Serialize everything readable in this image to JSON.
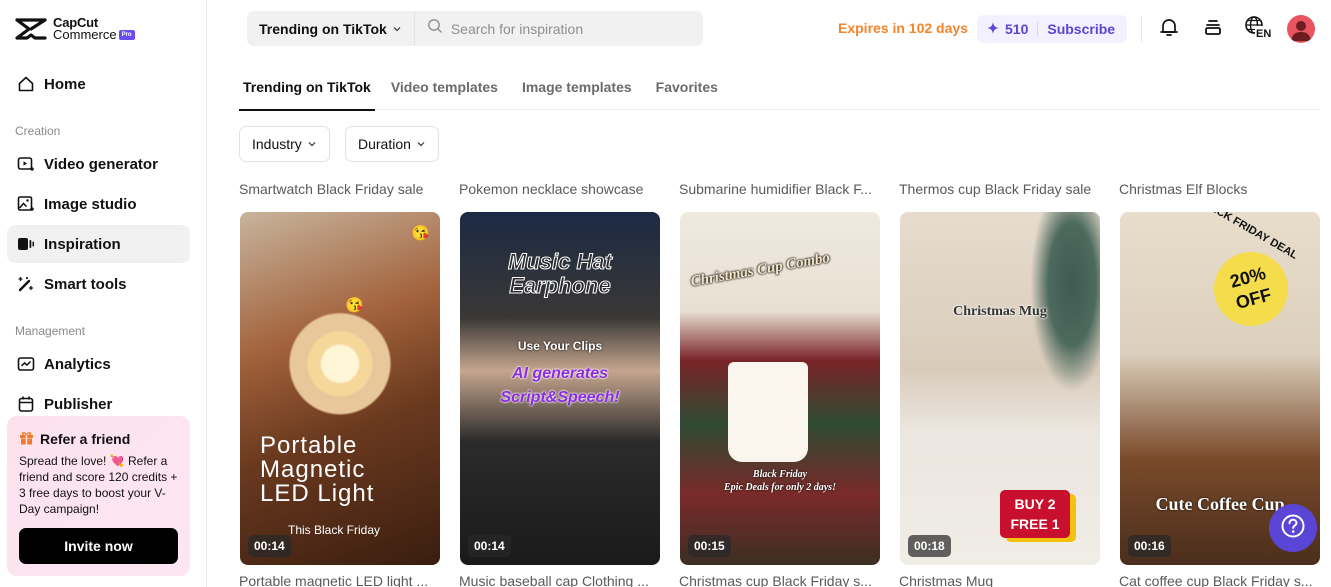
{
  "brand": {
    "line1": "CapCut",
    "line2": "Commerce",
    "badge": "Pro"
  },
  "sidebar": {
    "home": "Home",
    "creation_label": "Creation",
    "creation_items": [
      {
        "label": "Video generator",
        "icon": "video-sparkle-icon"
      },
      {
        "label": "Image studio",
        "icon": "image-sparkle-icon"
      },
      {
        "label": "Inspiration",
        "icon": "inspiration-icon",
        "active": true
      },
      {
        "label": "Smart tools",
        "icon": "magic-wand-icon"
      }
    ],
    "management_label": "Management",
    "management_items": [
      {
        "label": "Analytics",
        "icon": "analytics-icon"
      },
      {
        "label": "Publisher",
        "icon": "calendar-icon"
      }
    ],
    "refer": {
      "title": "Refer a friend",
      "body": "Spread the love! 💘 Refer a friend and score 120 credits + 3 free days to boost your V-Day campaign!",
      "button": "Invite now"
    }
  },
  "topbar": {
    "source_select": "Trending on TikTok",
    "search_placeholder": "Search for inspiration",
    "expires": "Expires in 102 days",
    "credits": "510",
    "subscribe": "Subscribe",
    "language": "EN",
    "colors": {
      "expires": "#f5842b",
      "accent": "#5b45d6",
      "avatar": "#e8545f"
    }
  },
  "tabs": [
    {
      "label": "Trending on TikTok",
      "active": true
    },
    {
      "label": "Video templates"
    },
    {
      "label": "Image templates"
    },
    {
      "label": "Favorites"
    }
  ],
  "filters": {
    "industry": "Industry",
    "duration": "Duration"
  },
  "row_titles_top": [
    "Smartwatch Black Friday sale",
    "Pokemon necklace showcase",
    "Submarine humidifier Black F...",
    "Thermos cup Black Friday sale",
    "Christmas Elf Blocks"
  ],
  "cards": [
    {
      "duration": "00:14",
      "overlay": "Portable\nMagnetic\nLED Light",
      "subtitle": "This Black Friday",
      "title": "Portable magnetic LED light ..."
    },
    {
      "duration": "00:14",
      "overlay": "Music Hat\nEarphone",
      "subtitle": "Use Your Clips",
      "tagline": "AI generates\nScript&Speech!",
      "title": "Music baseball cap Clothing ..."
    },
    {
      "duration": "00:15",
      "overlay": "Christmas Cup Combo",
      "subtitle": "Black Friday\nEpic Deals for only 2 days!",
      "title": "Christmas cup Black Friday s..."
    },
    {
      "duration": "00:18",
      "overlay": "Christmas Mug",
      "promo": "BUY 2\nFREE 1",
      "title": "Christmas Mug"
    },
    {
      "duration": "00:16",
      "overlay": "Cute Coffee Cup",
      "arc": "BLACK FRIDAY DEAL",
      "promo": "20%\nOFF",
      "title": "Cat coffee cup Black Friday s..."
    }
  ]
}
